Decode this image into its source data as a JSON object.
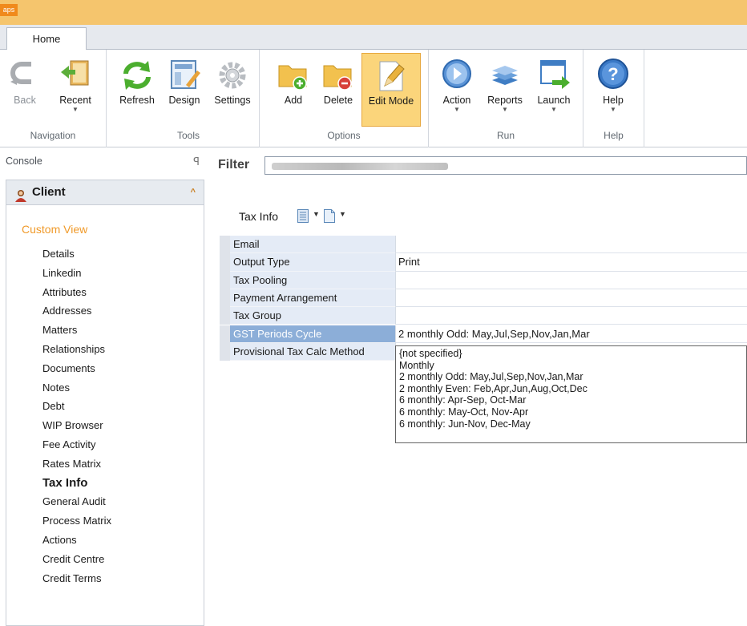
{
  "app": {
    "logo": "aps"
  },
  "tabs": [
    {
      "label": "Home"
    }
  ],
  "ribbon": {
    "groups": [
      {
        "label": "Navigation",
        "buttons": [
          {
            "label": "Back",
            "icon": "back-arrow-icon"
          },
          {
            "label": "Recent",
            "icon": "recent-book-icon"
          }
        ]
      },
      {
        "label": "Tools",
        "buttons": [
          {
            "label": "Refresh",
            "icon": "refresh-icon"
          },
          {
            "label": "Design",
            "icon": "design-icon"
          },
          {
            "label": "Settings",
            "icon": "gear-icon"
          }
        ]
      },
      {
        "label": "Options",
        "buttons": [
          {
            "label": "Add",
            "icon": "folder-add-icon"
          },
          {
            "label": "Delete",
            "icon": "folder-delete-icon"
          },
          {
            "label": "Edit Mode",
            "icon": "edit-pencil-icon"
          }
        ]
      },
      {
        "label": "Run",
        "buttons": [
          {
            "label": "Action",
            "icon": "play-icon"
          },
          {
            "label": "Reports",
            "icon": "reports-stack-icon"
          },
          {
            "label": "Launch",
            "icon": "launch-window-icon"
          }
        ]
      },
      {
        "label": "Help",
        "buttons": [
          {
            "label": "Help",
            "icon": "help-icon"
          }
        ]
      }
    ]
  },
  "console": {
    "title": "Console",
    "pin_glyph": "ꟼ",
    "client_title": "Client",
    "collapse_glyph": "^",
    "caption": "Custom View",
    "items": [
      "Details",
      "Linkedin",
      "Attributes",
      "Addresses",
      "Matters",
      "Relationships",
      "Documents",
      "Notes",
      "Debt",
      "WIP Browser",
      "Fee Activity",
      "Rates Matrix",
      "Tax Info",
      "General Audit",
      "Process Matrix",
      "Actions",
      "Credit Centre",
      "Credit Terms"
    ],
    "selected_item": "Tax Info"
  },
  "filter": {
    "label": "Filter"
  },
  "tax_info": {
    "title": "Tax Info",
    "rows": [
      {
        "name": "Email",
        "value": ""
      },
      {
        "name": "Output Type",
        "value": "Print"
      },
      {
        "name": "Tax Pooling",
        "value": ""
      },
      {
        "name": "Payment Arrangement",
        "value": ""
      },
      {
        "name": "Tax Group",
        "value": ""
      },
      {
        "name": "GST Periods Cycle",
        "value": "2 monthly Odd: May,Jul,Sep,Nov,Jan,Mar"
      },
      {
        "name": "Provisional Tax Calc Method",
        "value": ""
      }
    ],
    "selected_row": "GST Periods Cycle",
    "dropdown_options": [
      "{not specified}",
      "Monthly",
      "2 monthly Odd: May,Jul,Sep,Nov,Jan,Mar",
      "2 monthly Even: Feb,Apr,Jun,Aug,Oct,Dec",
      "6 monthly: Apr-Sep, Oct-Mar",
      "6 monthly: May-Oct, Nov-Apr",
      "6 monthly: Jun-Nov, Dec-May"
    ]
  },
  "colors": {
    "titlebar": "#f5c56d",
    "accent": "#f09a2a",
    "active_button": "#fbd57b",
    "selected_row": "#8caed8"
  }
}
